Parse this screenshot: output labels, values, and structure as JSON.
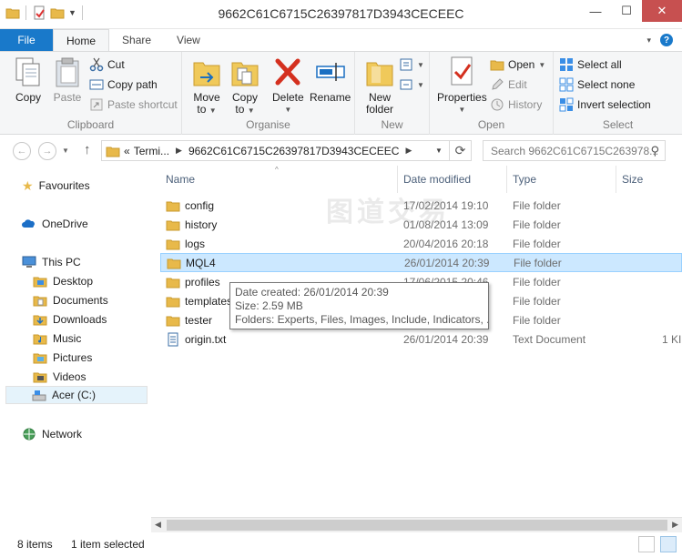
{
  "window": {
    "title": "9662C61C6715C26397817D3943CECEEC"
  },
  "tabs": {
    "file": "File",
    "home": "Home",
    "share": "Share",
    "view": "View"
  },
  "ribbon": {
    "clipboard": {
      "label": "Clipboard",
      "copy": "Copy",
      "paste": "Paste",
      "cut": "Cut",
      "copy_path": "Copy path",
      "paste_shortcut": "Paste shortcut"
    },
    "organise": {
      "label": "Organise",
      "move_to_1": "Move",
      "move_to_2": "to",
      "copy_to_1": "Copy",
      "copy_to_2": "to",
      "delete": "Delete",
      "rename": "Rename"
    },
    "new": {
      "label": "New",
      "new_folder_1": "New",
      "new_folder_2": "folder"
    },
    "open": {
      "label": "Open",
      "properties": "Properties",
      "open": "Open",
      "edit": "Edit",
      "history": "History"
    },
    "select": {
      "label": "Select",
      "select_all": "Select all",
      "select_none": "Select none",
      "invert": "Invert selection"
    }
  },
  "address": {
    "prefix": "«",
    "crumb1": "Termi...",
    "crumb2": "9662C61C6715C26397817D3943CECEEC",
    "search_placeholder": "Search 9662C61C6715C263978..."
  },
  "navpane": {
    "favourites": "Favourites",
    "onedrive": "OneDrive",
    "this_pc": "This PC",
    "desktop": "Desktop",
    "documents": "Documents",
    "downloads": "Downloads",
    "music": "Music",
    "pictures": "Pictures",
    "videos": "Videos",
    "drive": "Acer (C:)",
    "network": "Network"
  },
  "columns": {
    "name": "Name",
    "date": "Date modified",
    "type": "Type",
    "size": "Size"
  },
  "files": [
    {
      "name": "config",
      "date": "17/02/2014 19:10",
      "type": "File folder",
      "size": ""
    },
    {
      "name": "history",
      "date": "01/08/2014 13:09",
      "type": "File folder",
      "size": ""
    },
    {
      "name": "logs",
      "date": "20/04/2016 20:18",
      "type": "File folder",
      "size": ""
    },
    {
      "name": "MQL4",
      "date": "26/01/2014 20:39",
      "type": "File folder",
      "size": ""
    },
    {
      "name": "profiles",
      "date": "17/06/2015 20:46",
      "type": "File folder",
      "size": ""
    },
    {
      "name": "templates",
      "date": "",
      "type": "File folder",
      "size": ""
    },
    {
      "name": "tester",
      "date": "",
      "type": "File folder",
      "size": ""
    },
    {
      "name": "origin.txt",
      "date": "26/01/2014 20:39",
      "type": "Text Document",
      "size": "1 KI"
    }
  ],
  "tooltip": {
    "line1": "Date created: 26/01/2014 20:39",
    "line2": "Size: 2.59 MB",
    "line3": "Folders: Experts, Files, Images, Include, Indicators, ..."
  },
  "watermark": "图道交易",
  "status": {
    "items": "8 items",
    "selected": "1 item selected"
  },
  "colors": {
    "accent": "#1979ca",
    "selection": "#cce8ff",
    "folder": "#e8b94a"
  }
}
